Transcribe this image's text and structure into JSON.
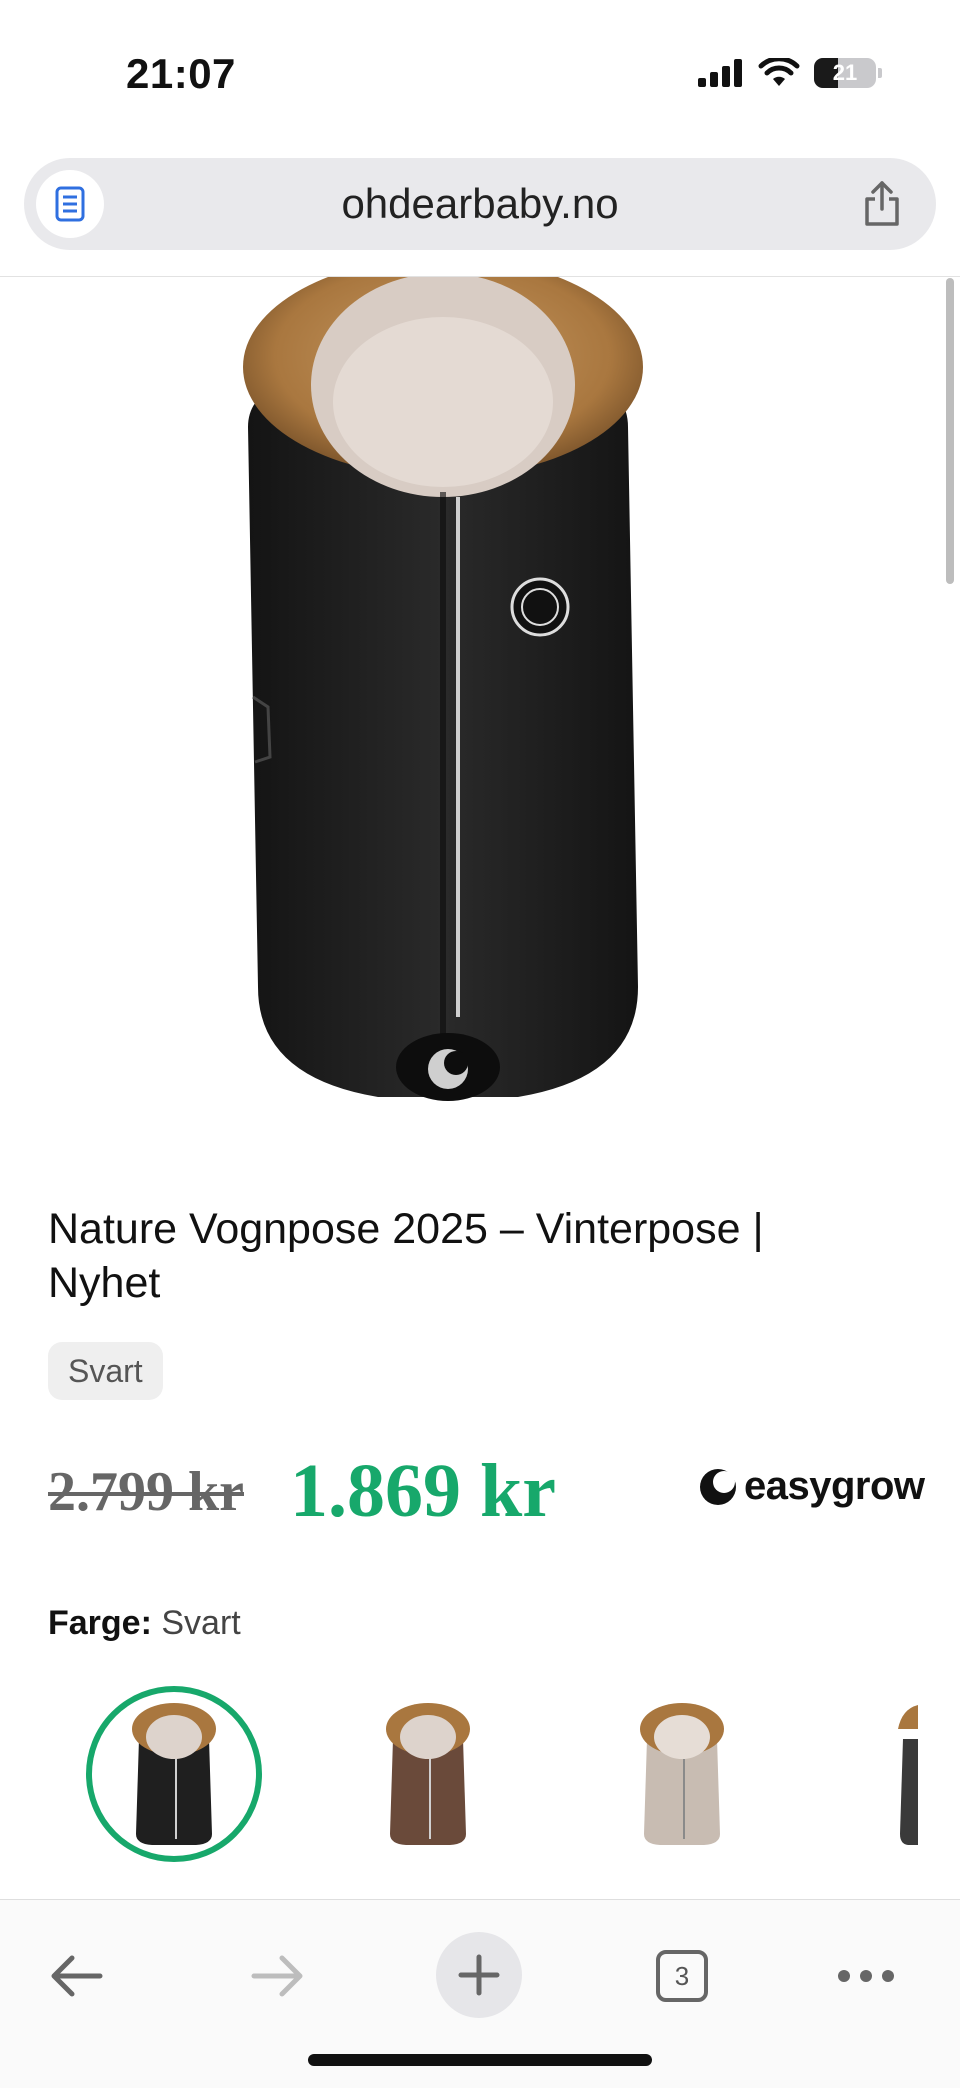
{
  "status": {
    "time": "21:07",
    "battery": "21"
  },
  "browser": {
    "url": "ohdearbaby.no",
    "open_tabs": "3"
  },
  "product": {
    "title": "Nature Vognpose 2025 – Vinterpose | Nyhet",
    "variant_chip": "Svart",
    "old_price": "2.799 kr",
    "new_price": "1.869 kr",
    "brand": "easygrow",
    "color_label": "Farge:",
    "color_value": "Svart"
  },
  "swatches": [
    {
      "name": "Svart",
      "body_color": "#1f1f1f",
      "selected": true
    },
    {
      "name": "Brun",
      "body_color": "#6a4a3a",
      "selected": false
    },
    {
      "name": "Beige",
      "body_color": "#c8bcb2",
      "selected": false
    },
    {
      "name": "Grå",
      "body_color": "#3a3a3a",
      "selected": false
    }
  ],
  "colors": {
    "accent": "#17a86b",
    "fur": "#a9773f"
  }
}
